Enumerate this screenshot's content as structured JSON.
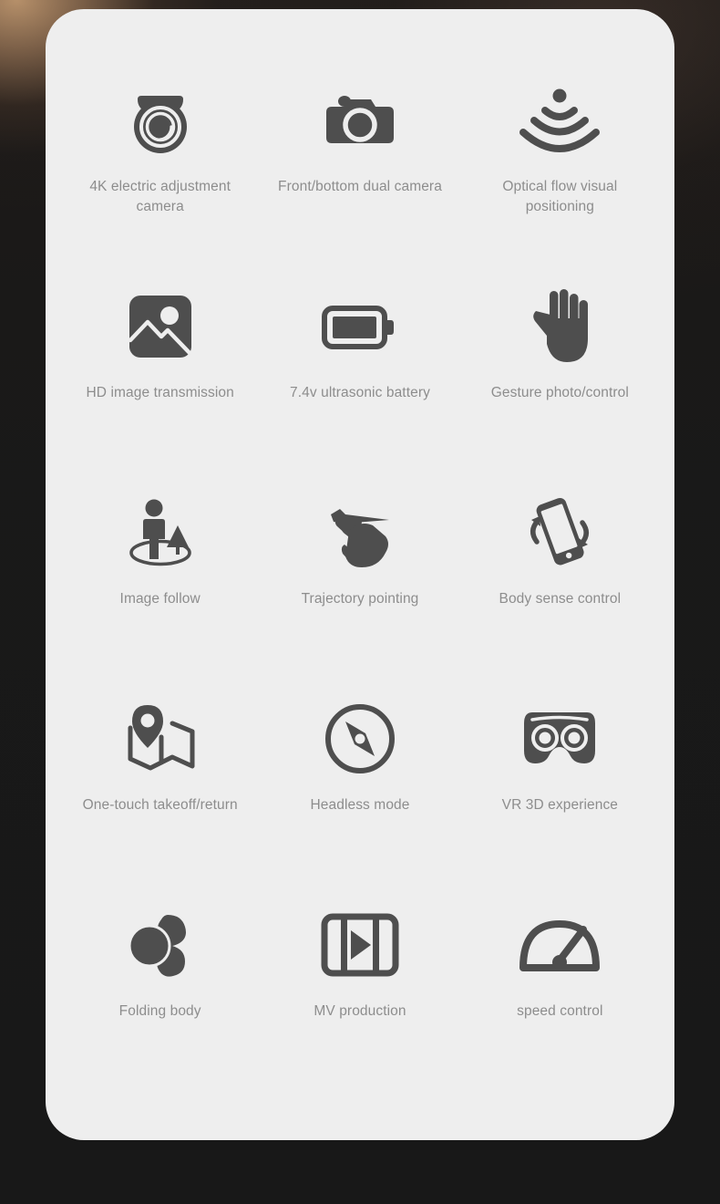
{
  "theme": {
    "card_background": "#eeeeee",
    "page_background": "#161616",
    "icon_color": "#4e4e4e",
    "label_color": "#8d8d8d",
    "accent_glow": "#be966e"
  },
  "card": {
    "features": [
      {
        "icon": "dome-camera-icon",
        "label": "4K electric adjustment camera"
      },
      {
        "icon": "photo-camera-icon",
        "label": "Front/bottom dual camera"
      },
      {
        "icon": "sonar-waves-icon",
        "label": "Optical flow visual positioning"
      },
      {
        "icon": "image-picture-icon",
        "label": "HD image transmission"
      },
      {
        "icon": "battery-full-icon",
        "label": "7.4v ultrasonic battery"
      },
      {
        "icon": "open-hand-icon",
        "label": "Gesture photo/control"
      },
      {
        "icon": "person-follow-icon",
        "label": "Image follow"
      },
      {
        "icon": "hand-swipe-icon",
        "label": "Trajectory pointing"
      },
      {
        "icon": "phone-tilt-icon",
        "label": "Body sense control"
      },
      {
        "icon": "map-pin-icon",
        "label": "One-touch takeoff/return"
      },
      {
        "icon": "compass-icon",
        "label": "Headless mode"
      },
      {
        "icon": "vr-goggles-icon",
        "label": "VR 3D experience"
      },
      {
        "icon": "folding-body-icon",
        "label": "Folding body"
      },
      {
        "icon": "film-play-icon",
        "label": "MV production"
      },
      {
        "icon": "speedometer-icon",
        "label": "speed control"
      }
    ]
  }
}
